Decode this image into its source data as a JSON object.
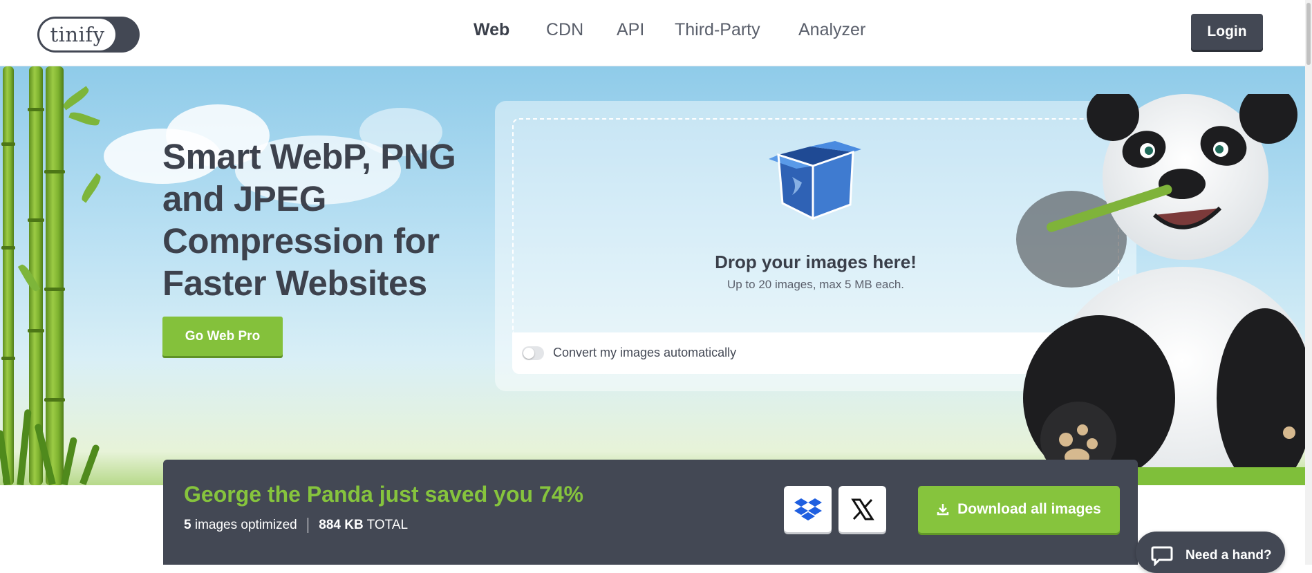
{
  "header": {
    "logo": "tinify",
    "nav": [
      {
        "label": "Web",
        "active": true
      },
      {
        "label": "CDN",
        "active": false
      },
      {
        "label": "API",
        "active": false
      },
      {
        "label": "Third-Party",
        "active": false
      },
      {
        "label": "Analyzer",
        "active": false
      }
    ],
    "login_label": "Login"
  },
  "hero": {
    "headline": "Smart WebP, PNG and JPEG Compression for Faster Websites",
    "cta_label": "Go Web Pro"
  },
  "dropzone": {
    "title": "Drop your images here!",
    "subtitle": "Up to 20 images, max 5 MB each.",
    "box_icon": "box-icon",
    "convert_label": "Convert my images automatically",
    "convert_enabled": false
  },
  "results": {
    "saved_text": "George the Panda just saved you 74%",
    "image_count": "5",
    "images_label": "images optimized",
    "total_size": "884 KB",
    "total_label": "TOTAL",
    "share_icons": [
      "dropbox-icon",
      "x-icon"
    ],
    "download_label": "Download all images",
    "download_icon": "download-icon"
  },
  "help": {
    "label": "Need a hand?",
    "icon": "chat-icon"
  },
  "colors": {
    "accent_green": "#86c43d",
    "dark": "#434854",
    "sky_top": "#8fcbe9"
  }
}
